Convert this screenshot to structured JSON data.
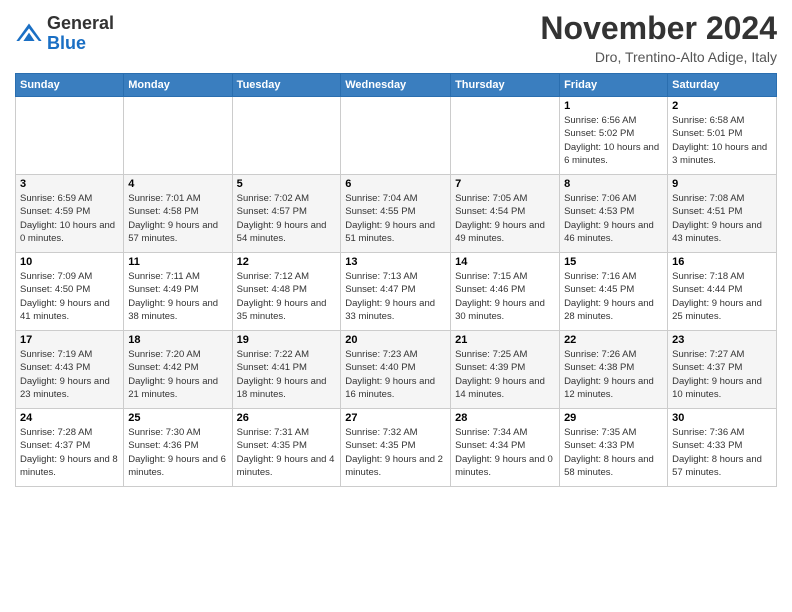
{
  "logo": {
    "general": "General",
    "blue": "Blue"
  },
  "title": "November 2024",
  "location": "Dro, Trentino-Alto Adige, Italy",
  "days_of_week": [
    "Sunday",
    "Monday",
    "Tuesday",
    "Wednesday",
    "Thursday",
    "Friday",
    "Saturday"
  ],
  "weeks": [
    [
      {
        "day": "",
        "info": ""
      },
      {
        "day": "",
        "info": ""
      },
      {
        "day": "",
        "info": ""
      },
      {
        "day": "",
        "info": ""
      },
      {
        "day": "",
        "info": ""
      },
      {
        "day": "1",
        "info": "Sunrise: 6:56 AM\nSunset: 5:02 PM\nDaylight: 10 hours and 6 minutes."
      },
      {
        "day": "2",
        "info": "Sunrise: 6:58 AM\nSunset: 5:01 PM\nDaylight: 10 hours and 3 minutes."
      }
    ],
    [
      {
        "day": "3",
        "info": "Sunrise: 6:59 AM\nSunset: 4:59 PM\nDaylight: 10 hours and 0 minutes."
      },
      {
        "day": "4",
        "info": "Sunrise: 7:01 AM\nSunset: 4:58 PM\nDaylight: 9 hours and 57 minutes."
      },
      {
        "day": "5",
        "info": "Sunrise: 7:02 AM\nSunset: 4:57 PM\nDaylight: 9 hours and 54 minutes."
      },
      {
        "day": "6",
        "info": "Sunrise: 7:04 AM\nSunset: 4:55 PM\nDaylight: 9 hours and 51 minutes."
      },
      {
        "day": "7",
        "info": "Sunrise: 7:05 AM\nSunset: 4:54 PM\nDaylight: 9 hours and 49 minutes."
      },
      {
        "day": "8",
        "info": "Sunrise: 7:06 AM\nSunset: 4:53 PM\nDaylight: 9 hours and 46 minutes."
      },
      {
        "day": "9",
        "info": "Sunrise: 7:08 AM\nSunset: 4:51 PM\nDaylight: 9 hours and 43 minutes."
      }
    ],
    [
      {
        "day": "10",
        "info": "Sunrise: 7:09 AM\nSunset: 4:50 PM\nDaylight: 9 hours and 41 minutes."
      },
      {
        "day": "11",
        "info": "Sunrise: 7:11 AM\nSunset: 4:49 PM\nDaylight: 9 hours and 38 minutes."
      },
      {
        "day": "12",
        "info": "Sunrise: 7:12 AM\nSunset: 4:48 PM\nDaylight: 9 hours and 35 minutes."
      },
      {
        "day": "13",
        "info": "Sunrise: 7:13 AM\nSunset: 4:47 PM\nDaylight: 9 hours and 33 minutes."
      },
      {
        "day": "14",
        "info": "Sunrise: 7:15 AM\nSunset: 4:46 PM\nDaylight: 9 hours and 30 minutes."
      },
      {
        "day": "15",
        "info": "Sunrise: 7:16 AM\nSunset: 4:45 PM\nDaylight: 9 hours and 28 minutes."
      },
      {
        "day": "16",
        "info": "Sunrise: 7:18 AM\nSunset: 4:44 PM\nDaylight: 9 hours and 25 minutes."
      }
    ],
    [
      {
        "day": "17",
        "info": "Sunrise: 7:19 AM\nSunset: 4:43 PM\nDaylight: 9 hours and 23 minutes."
      },
      {
        "day": "18",
        "info": "Sunrise: 7:20 AM\nSunset: 4:42 PM\nDaylight: 9 hours and 21 minutes."
      },
      {
        "day": "19",
        "info": "Sunrise: 7:22 AM\nSunset: 4:41 PM\nDaylight: 9 hours and 18 minutes."
      },
      {
        "day": "20",
        "info": "Sunrise: 7:23 AM\nSunset: 4:40 PM\nDaylight: 9 hours and 16 minutes."
      },
      {
        "day": "21",
        "info": "Sunrise: 7:25 AM\nSunset: 4:39 PM\nDaylight: 9 hours and 14 minutes."
      },
      {
        "day": "22",
        "info": "Sunrise: 7:26 AM\nSunset: 4:38 PM\nDaylight: 9 hours and 12 minutes."
      },
      {
        "day": "23",
        "info": "Sunrise: 7:27 AM\nSunset: 4:37 PM\nDaylight: 9 hours and 10 minutes."
      }
    ],
    [
      {
        "day": "24",
        "info": "Sunrise: 7:28 AM\nSunset: 4:37 PM\nDaylight: 9 hours and 8 minutes."
      },
      {
        "day": "25",
        "info": "Sunrise: 7:30 AM\nSunset: 4:36 PM\nDaylight: 9 hours and 6 minutes."
      },
      {
        "day": "26",
        "info": "Sunrise: 7:31 AM\nSunset: 4:35 PM\nDaylight: 9 hours and 4 minutes."
      },
      {
        "day": "27",
        "info": "Sunrise: 7:32 AM\nSunset: 4:35 PM\nDaylight: 9 hours and 2 minutes."
      },
      {
        "day": "28",
        "info": "Sunrise: 7:34 AM\nSunset: 4:34 PM\nDaylight: 9 hours and 0 minutes."
      },
      {
        "day": "29",
        "info": "Sunrise: 7:35 AM\nSunset: 4:33 PM\nDaylight: 8 hours and 58 minutes."
      },
      {
        "day": "30",
        "info": "Sunrise: 7:36 AM\nSunset: 4:33 PM\nDaylight: 8 hours and 57 minutes."
      }
    ]
  ]
}
